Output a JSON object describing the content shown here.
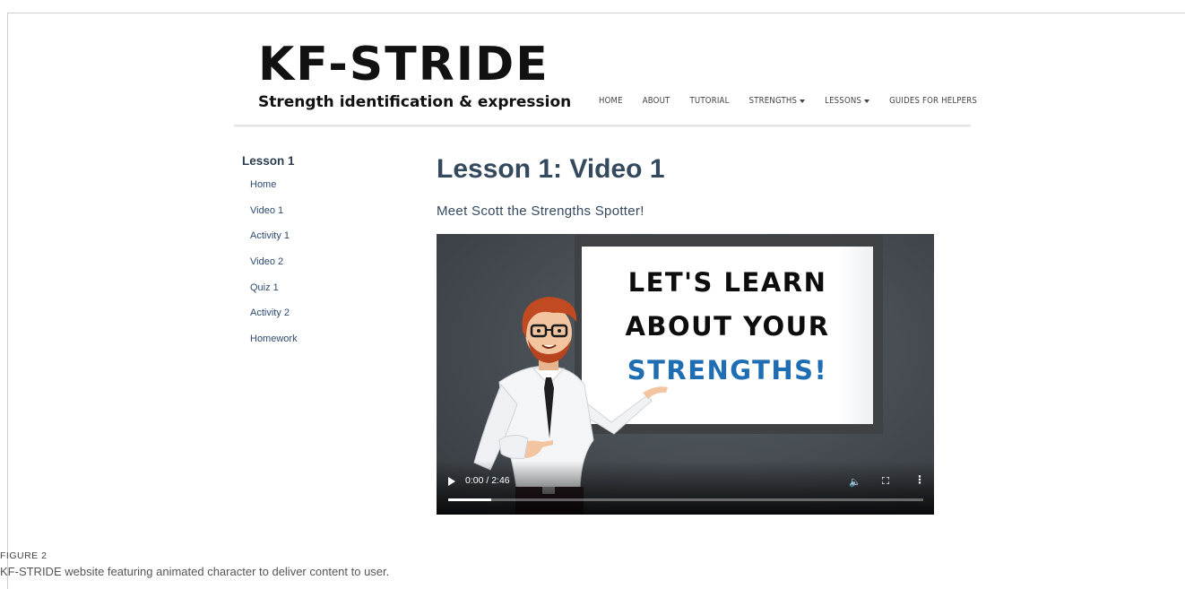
{
  "site": {
    "logo_title": "KF-STRIDE",
    "logo_subtitle": "Strength identification & expression"
  },
  "nav": {
    "items": [
      {
        "label": "HOME",
        "dropdown": false
      },
      {
        "label": "ABOUT",
        "dropdown": false
      },
      {
        "label": "TUTORIAL",
        "dropdown": false
      },
      {
        "label": "STRENGTHS",
        "dropdown": true
      },
      {
        "label": "LESSONS",
        "dropdown": true
      },
      {
        "label": "GUIDES FOR HELPERS",
        "dropdown": false
      }
    ]
  },
  "sidebar": {
    "title": "Lesson 1",
    "items": [
      {
        "label": "Home"
      },
      {
        "label": "Video 1"
      },
      {
        "label": "Activity 1"
      },
      {
        "label": "Video 2"
      },
      {
        "label": "Quiz 1"
      },
      {
        "label": "Activity 2"
      },
      {
        "label": "Homework"
      }
    ]
  },
  "main": {
    "title": "Lesson 1: Video 1",
    "subtitle": "Meet Scott the Strengths Spotter!"
  },
  "video": {
    "board_lines": [
      "LET'S LEARN",
      "ABOUT YOUR",
      "STRENGTHS!"
    ],
    "time": "0:00 / 2:46",
    "progress_fraction": 0.09,
    "icons": {
      "play": "play-icon",
      "volume": "volume-icon",
      "fullscreen": "fullscreen-icon",
      "more": "more-options-icon"
    }
  },
  "figure": {
    "label": "FIGURE 2",
    "caption": "KF-STRIDE website featuring animated character to deliver content to user."
  },
  "colors": {
    "heading": "#34495e",
    "sidebar_link": "#2d4a6e",
    "board_accent": "#1f6db3",
    "video_bg": "#454b51"
  }
}
